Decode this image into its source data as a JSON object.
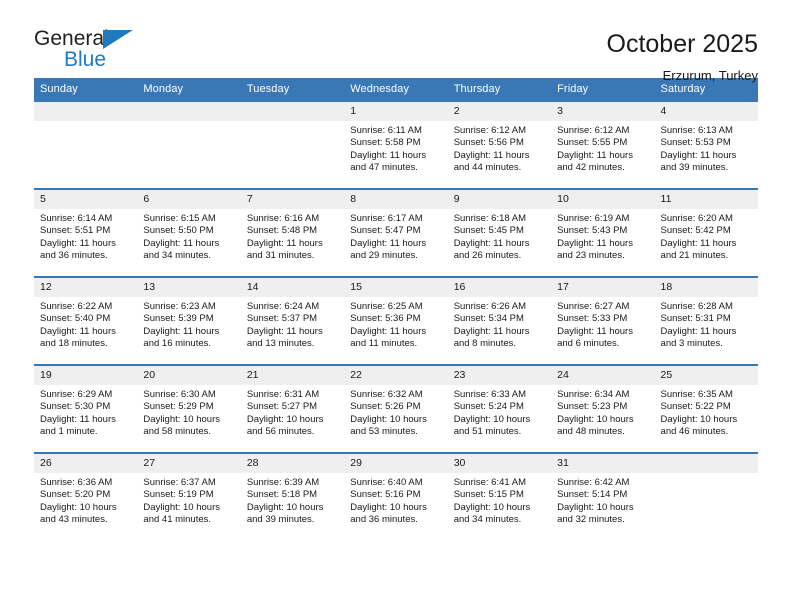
{
  "brand": {
    "name_top": "General",
    "name_bottom": "Blue",
    "flag_icon": "triangle-flag-icon",
    "color_blue": "#1f7ac0",
    "color_dark": "#231f20"
  },
  "header": {
    "title": "October 2025",
    "subtitle": "Erzurum, Turkey"
  },
  "theme": {
    "header_blue": "#3a78b5",
    "daynum_band": "#efefef",
    "cell_bg": "#ffffff",
    "text": "#1a1a1a"
  },
  "weekdays": [
    "Sunday",
    "Monday",
    "Tuesday",
    "Wednesday",
    "Thursday",
    "Friday",
    "Saturday"
  ],
  "weeks": [
    [
      {
        "day": "",
        "empty": true,
        "lines": []
      },
      {
        "day": "",
        "empty": true,
        "lines": []
      },
      {
        "day": "",
        "empty": true,
        "lines": []
      },
      {
        "day": "1",
        "empty": false,
        "lines": [
          "Sunrise: 6:11 AM",
          "Sunset: 5:58 PM",
          "Daylight: 11 hours",
          "and 47 minutes."
        ]
      },
      {
        "day": "2",
        "empty": false,
        "lines": [
          "Sunrise: 6:12 AM",
          "Sunset: 5:56 PM",
          "Daylight: 11 hours",
          "and 44 minutes."
        ]
      },
      {
        "day": "3",
        "empty": false,
        "lines": [
          "Sunrise: 6:12 AM",
          "Sunset: 5:55 PM",
          "Daylight: 11 hours",
          "and 42 minutes."
        ]
      },
      {
        "day": "4",
        "empty": false,
        "lines": [
          "Sunrise: 6:13 AM",
          "Sunset: 5:53 PM",
          "Daylight: 11 hours",
          "and 39 minutes."
        ]
      }
    ],
    [
      {
        "day": "5",
        "empty": false,
        "lines": [
          "Sunrise: 6:14 AM",
          "Sunset: 5:51 PM",
          "Daylight: 11 hours",
          "and 36 minutes."
        ]
      },
      {
        "day": "6",
        "empty": false,
        "lines": [
          "Sunrise: 6:15 AM",
          "Sunset: 5:50 PM",
          "Daylight: 11 hours",
          "and 34 minutes."
        ]
      },
      {
        "day": "7",
        "empty": false,
        "lines": [
          "Sunrise: 6:16 AM",
          "Sunset: 5:48 PM",
          "Daylight: 11 hours",
          "and 31 minutes."
        ]
      },
      {
        "day": "8",
        "empty": false,
        "lines": [
          "Sunrise: 6:17 AM",
          "Sunset: 5:47 PM",
          "Daylight: 11 hours",
          "and 29 minutes."
        ]
      },
      {
        "day": "9",
        "empty": false,
        "lines": [
          "Sunrise: 6:18 AM",
          "Sunset: 5:45 PM",
          "Daylight: 11 hours",
          "and 26 minutes."
        ]
      },
      {
        "day": "10",
        "empty": false,
        "lines": [
          "Sunrise: 6:19 AM",
          "Sunset: 5:43 PM",
          "Daylight: 11 hours",
          "and 23 minutes."
        ]
      },
      {
        "day": "11",
        "empty": false,
        "lines": [
          "Sunrise: 6:20 AM",
          "Sunset: 5:42 PM",
          "Daylight: 11 hours",
          "and 21 minutes."
        ]
      }
    ],
    [
      {
        "day": "12",
        "empty": false,
        "lines": [
          "Sunrise: 6:22 AM",
          "Sunset: 5:40 PM",
          "Daylight: 11 hours",
          "and 18 minutes."
        ]
      },
      {
        "day": "13",
        "empty": false,
        "lines": [
          "Sunrise: 6:23 AM",
          "Sunset: 5:39 PM",
          "Daylight: 11 hours",
          "and 16 minutes."
        ]
      },
      {
        "day": "14",
        "empty": false,
        "lines": [
          "Sunrise: 6:24 AM",
          "Sunset: 5:37 PM",
          "Daylight: 11 hours",
          "and 13 minutes."
        ]
      },
      {
        "day": "15",
        "empty": false,
        "lines": [
          "Sunrise: 6:25 AM",
          "Sunset: 5:36 PM",
          "Daylight: 11 hours",
          "and 11 minutes."
        ]
      },
      {
        "day": "16",
        "empty": false,
        "lines": [
          "Sunrise: 6:26 AM",
          "Sunset: 5:34 PM",
          "Daylight: 11 hours",
          "and 8 minutes."
        ]
      },
      {
        "day": "17",
        "empty": false,
        "lines": [
          "Sunrise: 6:27 AM",
          "Sunset: 5:33 PM",
          "Daylight: 11 hours",
          "and 6 minutes."
        ]
      },
      {
        "day": "18",
        "empty": false,
        "lines": [
          "Sunrise: 6:28 AM",
          "Sunset: 5:31 PM",
          "Daylight: 11 hours",
          "and 3 minutes."
        ]
      }
    ],
    [
      {
        "day": "19",
        "empty": false,
        "lines": [
          "Sunrise: 6:29 AM",
          "Sunset: 5:30 PM",
          "Daylight: 11 hours",
          "and 1 minute."
        ]
      },
      {
        "day": "20",
        "empty": false,
        "lines": [
          "Sunrise: 6:30 AM",
          "Sunset: 5:29 PM",
          "Daylight: 10 hours",
          "and 58 minutes."
        ]
      },
      {
        "day": "21",
        "empty": false,
        "lines": [
          "Sunrise: 6:31 AM",
          "Sunset: 5:27 PM",
          "Daylight: 10 hours",
          "and 56 minutes."
        ]
      },
      {
        "day": "22",
        "empty": false,
        "lines": [
          "Sunrise: 6:32 AM",
          "Sunset: 5:26 PM",
          "Daylight: 10 hours",
          "and 53 minutes."
        ]
      },
      {
        "day": "23",
        "empty": false,
        "lines": [
          "Sunrise: 6:33 AM",
          "Sunset: 5:24 PM",
          "Daylight: 10 hours",
          "and 51 minutes."
        ]
      },
      {
        "day": "24",
        "empty": false,
        "lines": [
          "Sunrise: 6:34 AM",
          "Sunset: 5:23 PM",
          "Daylight: 10 hours",
          "and 48 minutes."
        ]
      },
      {
        "day": "25",
        "empty": false,
        "lines": [
          "Sunrise: 6:35 AM",
          "Sunset: 5:22 PM",
          "Daylight: 10 hours",
          "and 46 minutes."
        ]
      }
    ],
    [
      {
        "day": "26",
        "empty": false,
        "lines": [
          "Sunrise: 6:36 AM",
          "Sunset: 5:20 PM",
          "Daylight: 10 hours",
          "and 43 minutes."
        ]
      },
      {
        "day": "27",
        "empty": false,
        "lines": [
          "Sunrise: 6:37 AM",
          "Sunset: 5:19 PM",
          "Daylight: 10 hours",
          "and 41 minutes."
        ]
      },
      {
        "day": "28",
        "empty": false,
        "lines": [
          "Sunrise: 6:39 AM",
          "Sunset: 5:18 PM",
          "Daylight: 10 hours",
          "and 39 minutes."
        ]
      },
      {
        "day": "29",
        "empty": false,
        "lines": [
          "Sunrise: 6:40 AM",
          "Sunset: 5:16 PM",
          "Daylight: 10 hours",
          "and 36 minutes."
        ]
      },
      {
        "day": "30",
        "empty": false,
        "lines": [
          "Sunrise: 6:41 AM",
          "Sunset: 5:15 PM",
          "Daylight: 10 hours",
          "and 34 minutes."
        ]
      },
      {
        "day": "31",
        "empty": false,
        "lines": [
          "Sunrise: 6:42 AM",
          "Sunset: 5:14 PM",
          "Daylight: 10 hours",
          "and 32 minutes."
        ]
      },
      {
        "day": "",
        "empty": true,
        "lines": []
      }
    ]
  ]
}
